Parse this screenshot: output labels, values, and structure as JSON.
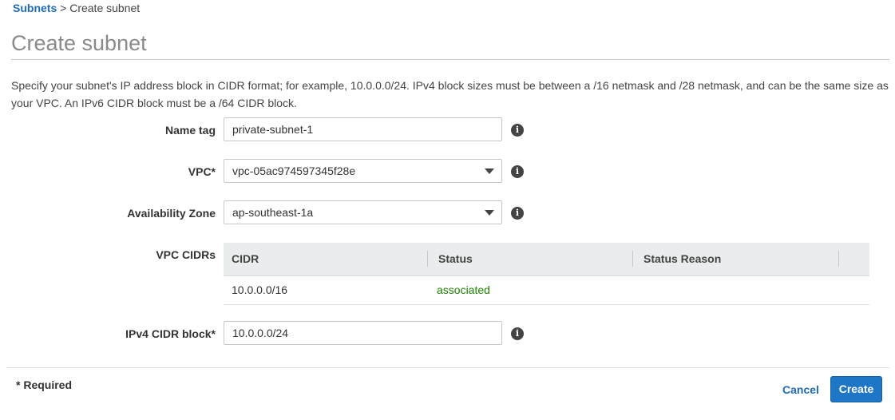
{
  "breadcrumb": {
    "parent": "Subnets",
    "separator": " > ",
    "current": "Create subnet"
  },
  "page": {
    "title": "Create subnet",
    "description": "Specify your subnet's IP address block in CIDR format; for example, 10.0.0.0/24. IPv4 block sizes must be between a /16 netmask and /28 netmask, and can be the same size as your VPC. An IPv6 CIDR block must be a /64 CIDR block."
  },
  "form": {
    "name_tag": {
      "label": "Name tag",
      "value": "private-subnet-1"
    },
    "vpc": {
      "label": "VPC*",
      "value": "vpc-05ac974597345f28e"
    },
    "availability_zone": {
      "label": "Availability Zone",
      "value": "ap-southeast-1a"
    },
    "vpc_cidrs": {
      "label": "VPC CIDRs",
      "columns": [
        "CIDR",
        "Status",
        "Status Reason"
      ],
      "rows": [
        {
          "cidr": "10.0.0.0/16",
          "status": "associated",
          "status_reason": ""
        }
      ]
    },
    "ipv4_cidr": {
      "label": "IPv4 CIDR block*",
      "value": "10.0.0.0/24"
    },
    "info_icon_glyph": "i"
  },
  "footer": {
    "required_note": "* Required",
    "cancel_label": "Cancel",
    "create_label": "Create"
  },
  "colors": {
    "link": "#1e6bb8",
    "primary_button": "#1e76c6",
    "status_associated": "#1d8102"
  }
}
